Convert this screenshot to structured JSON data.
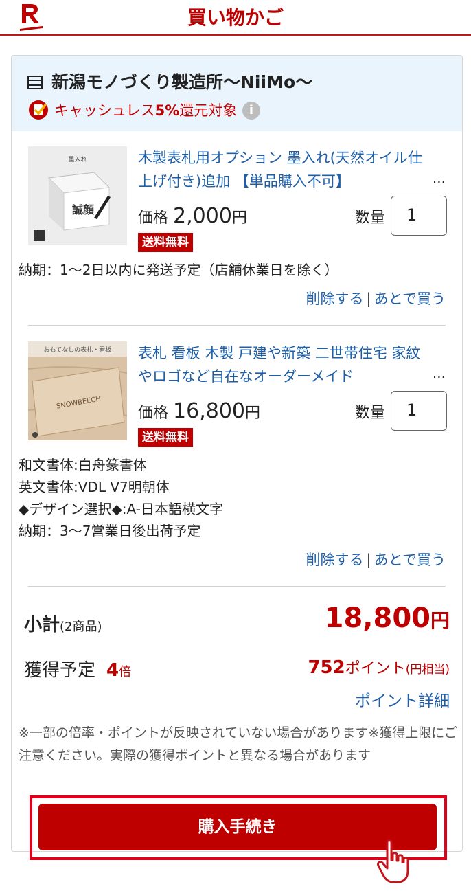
{
  "header": {
    "title": "買い物かご"
  },
  "shop": {
    "name": "新潟モノづくり製造所〜NiiMo〜",
    "cashless_prefix": "キャッシュレス",
    "cashless_rate": "5%",
    "cashless_suffix": "還元対象",
    "info": "i"
  },
  "items": [
    {
      "title": "木製表札用オプション 墨入れ(天然オイル仕上げ付き)追加 【単品購入不可】",
      "ellipsis": "...",
      "price_label": "価格",
      "price": "2,000",
      "yen": "円",
      "qty_label": "数量",
      "qty": "1",
      "badge": "送料無料",
      "thumb_caption": "墨入れ",
      "thumb_text": "誠顔",
      "specs": [
        "納期：1〜2日以内に発送予定（店舗休業日を除く）"
      ],
      "delete": "削除する",
      "separator": "|",
      "later": "あとで買う"
    },
    {
      "title": "表札 看板 木製 戸建や新築 二世帯住宅 家紋やロゴなど自在なオーダーメイド",
      "ellipsis": "...",
      "price_label": "価格",
      "price": "16,800",
      "yen": "円",
      "qty_label": "数量",
      "qty": "1",
      "badge": "送料無料",
      "thumb_caption": "おもてなしの表札・看板",
      "thumb_text": "SNOWBEECH",
      "specs": [
        "和文書体:白舟篆書体",
        "英文書体:VDL V7明朝体",
        "◆デザイン選択◆:A-日本語横文字",
        "納期：3〜7営業日後出荷予定"
      ],
      "delete": "削除する",
      "separator": "|",
      "later": "あとで買う"
    }
  ],
  "summary": {
    "subtotal_label": "小計",
    "subtotal_count": "(2商品)",
    "subtotal_value": "18,800",
    "yen": "円",
    "earn_label": "獲得予定",
    "earn_multiplier": "4",
    "earn_multiplier_unit": "倍",
    "points_value": "752",
    "points_unit": "ポイント",
    "points_equiv": "(円相当)",
    "points_detail": "ポイント詳細",
    "note": "※一部の倍率・ポイントが反映されていない場合があります※獲得上限にご注意ください。実際の獲得ポイントと異なる場合があります",
    "buy_button": "購入手続き"
  },
  "colors": {
    "brand": "#bf0000",
    "link": "#1f5fa8",
    "shop_bg": "#e9f4fc"
  }
}
